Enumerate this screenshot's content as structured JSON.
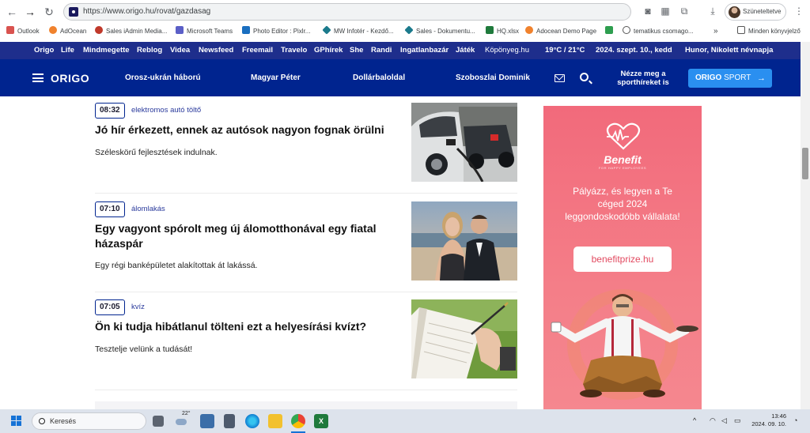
{
  "browser": {
    "url": "https://www.origo.hu/rovat/gazdasag",
    "profile_label": "Szüneteltetve"
  },
  "bookmarks": [
    {
      "label": "Outlook",
      "color": "#d9534f"
    },
    {
      "label": "AdOcean",
      "color": "#f0822d"
    },
    {
      "label": "Sales iAdmin Media...",
      "color": "#c0392b"
    },
    {
      "label": "Microsoft Teams",
      "color": "#5b5fc7"
    },
    {
      "label": "Photo Editor : Pixlr...",
      "color": "#1a6fc0"
    },
    {
      "label": "MW Infotér - Kezdő...",
      "color": "#1b7a8c"
    },
    {
      "label": "Sales - Dokumentu...",
      "color": "#1b7a8c"
    },
    {
      "label": "HQ.xlsx",
      "color": "#1f7a3c"
    },
    {
      "label": "Adocean Demo Page",
      "color": "#f0822d"
    },
    {
      "label": "",
      "color": "#2e9e4f"
    },
    {
      "label": "tematikus csomago...",
      "color": "#555555"
    },
    {
      "label": "Minden könyvjelző",
      "color": "#555555"
    }
  ],
  "topnav": {
    "items": [
      "Origo",
      "Life",
      "Mindmegette",
      "Reblog",
      "Videa",
      "Newsfeed",
      "Freemail",
      "Travelo",
      "GPhírek",
      "She",
      "Randi",
      "Ingatlanbazár",
      "Játék",
      "Köpönyeg.hu"
    ],
    "weather": "19°C / 21°C",
    "date": "2024. szept. 10., kedd",
    "nameday": "Hunor, Nikolett névnapja"
  },
  "mainnav": {
    "logo": "ORIGO",
    "links": [
      "Orosz-ukrán háború",
      "Magyar Péter",
      "Dollárbaloldal",
      "Szoboszlai Dominik"
    ],
    "sport_promo": "Nézze meg a sporthíreket is",
    "sport_button_bold": "ORIGO",
    "sport_button_thin": "SPORT",
    "sport_arrow": "→"
  },
  "articles": [
    {
      "time": "08:32",
      "tag": "elektromos autó töltő",
      "title": "Jó hír érkezett, ennek az autósok nagyon fognak örülni",
      "lead": "Széleskörű fejlesztések indulnak."
    },
    {
      "time": "07:10",
      "tag": "álomlakás",
      "title": "Egy vagyont spórolt meg új álomotthonával egy fiatal házaspár",
      "lead": "Egy régi banképületet alakítottak át lakássá."
    },
    {
      "time": "07:05",
      "tag": "kvíz",
      "title": "Ön ki tudja hibátlanul tölteni ezt a helyesírási kvízt?",
      "lead": "Tesztelje velünk a tudását!"
    }
  ],
  "ad": {
    "brand": "Benefit",
    "subtitle": "FOR HAPPY EMPLOYEES",
    "text": "Pályázz, és legyen a Te céged 2024 leggondoskodóbb vállalata!",
    "cta": "benefitprize.hu"
  },
  "taskbar": {
    "search_label": "Keresés",
    "weather_temp": "22°",
    "time": "13:46",
    "date": "2024. 09. 10."
  }
}
